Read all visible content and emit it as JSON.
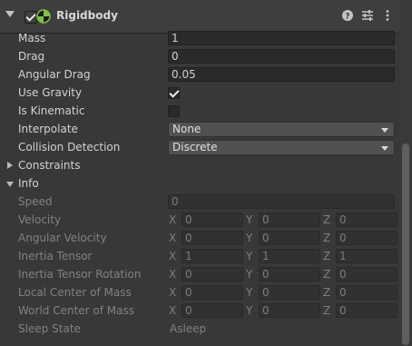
{
  "component": {
    "title": "Rigidbody",
    "enabled": true,
    "icons": [
      "help-icon",
      "preset-icon",
      "context-menu-icon"
    ]
  },
  "fields": {
    "mass": {
      "label": "Mass",
      "value": "1"
    },
    "drag": {
      "label": "Drag",
      "value": "0"
    },
    "angular_drag": {
      "label": "Angular Drag",
      "value": "0.05"
    },
    "use_gravity": {
      "label": "Use Gravity",
      "checked": true
    },
    "is_kinematic": {
      "label": "Is Kinematic",
      "checked": false
    },
    "interpolate": {
      "label": "Interpolate",
      "value": "None"
    },
    "collision_detection": {
      "label": "Collision Detection",
      "value": "Discrete"
    }
  },
  "constraints": {
    "label": "Constraints",
    "expanded": false
  },
  "info": {
    "label": "Info",
    "expanded": true,
    "speed": {
      "label": "Speed",
      "value": "0"
    },
    "axes": {
      "x": "X",
      "y": "Y",
      "z": "Z"
    },
    "vectors": [
      {
        "label": "Velocity",
        "x": "0",
        "y": "0",
        "z": "0"
      },
      {
        "label": "Angular Velocity",
        "x": "0",
        "y": "0",
        "z": "0"
      },
      {
        "label": "Inertia Tensor",
        "x": "1",
        "y": "1",
        "z": "1"
      },
      {
        "label": "Inertia Tensor Rotation",
        "x": "0",
        "y": "0",
        "z": "0"
      },
      {
        "label": "Local Center of Mass",
        "x": "0",
        "y": "0",
        "z": "0"
      },
      {
        "label": "World Center of Mass",
        "x": "0",
        "y": "0",
        "z": "0"
      }
    ],
    "sleep_state": {
      "label": "Sleep State",
      "value": "Asleep"
    }
  },
  "colors": {
    "panel": "#383838",
    "accent_rigidbody": "#7cc243"
  }
}
